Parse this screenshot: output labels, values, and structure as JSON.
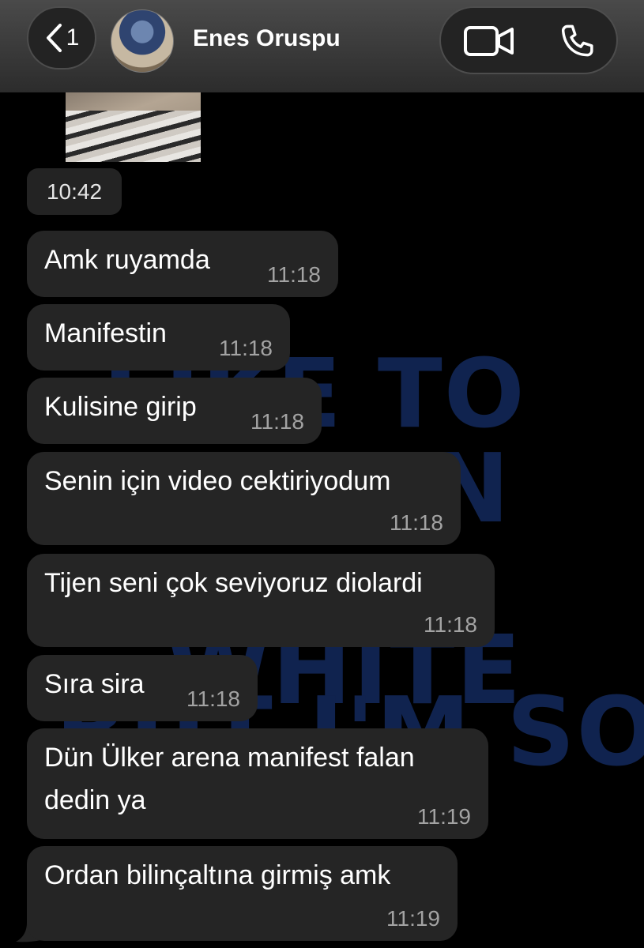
{
  "header": {
    "back_count": "1",
    "contact_name": "Enes Oruspu",
    "back_icon": "chevron-left-icon",
    "video_icon": "video-camera-icon",
    "call_icon": "phone-icon"
  },
  "wallpaper": {
    "lines": [
      "LIKE TO",
      "LIVE IN",
      "WHITE",
      "BUT I'M SO"
    ]
  },
  "chat": {
    "photo_time": "10:42",
    "messages": [
      {
        "text": "Amk ruyamda",
        "time": "11:18"
      },
      {
        "text": "Manifestin",
        "time": "11:18"
      },
      {
        "text": "Kulisine girip",
        "time": "11:18"
      },
      {
        "text": "Senin için video cektiriyodum",
        "time": "11:18"
      },
      {
        "text": "Tijen seni çok seviyoruz diolardi",
        "time": "11:18"
      },
      {
        "text": "Sıra sira",
        "time": "11:18"
      },
      {
        "text": "Dün Ülker arena manifest falan",
        "text2": "dedin ya",
        "time": "11:19"
      },
      {
        "text": "Ordan bilinçaltına girmiş amk",
        "time": "11:19"
      }
    ]
  },
  "colors": {
    "background": "#000000",
    "bubble": "#252525",
    "header": "#3a3a3a",
    "time_text": "#a3a3a3",
    "wallpaper_text": "#10234f"
  }
}
